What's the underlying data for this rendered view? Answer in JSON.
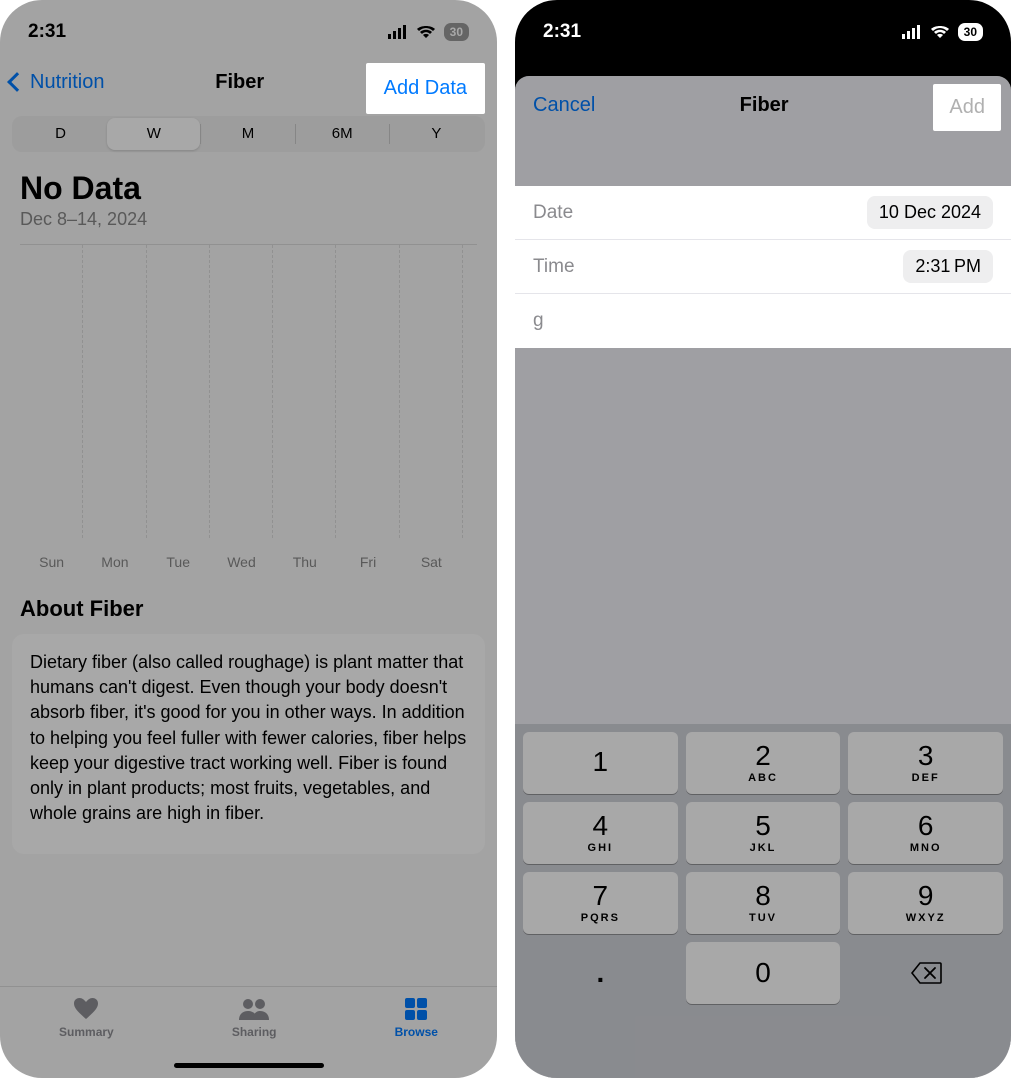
{
  "left": {
    "status": {
      "time": "2:31",
      "battery": "30"
    },
    "nav": {
      "back": "Nutrition",
      "title": "Fiber",
      "add_data": "Add Data"
    },
    "segments": [
      "D",
      "W",
      "M",
      "6M",
      "Y"
    ],
    "segment_selected": 1,
    "chart": {
      "heading": "No Data",
      "range": "Dec 8–14, 2024",
      "days": [
        "Sun",
        "Mon",
        "Tue",
        "Wed",
        "Thu",
        "Fri",
        "Sat"
      ]
    },
    "about": {
      "title": "About Fiber",
      "body": "Dietary fiber (also called roughage) is plant matter that humans can't digest. Even though your body doesn't absorb fiber, it's good for you in other ways. In addition to helping you feel fuller with fewer calories, fiber helps keep your digestive tract working well. Fiber is found only in plant products; most fruits, vegetables, and whole grains are high in fiber."
    },
    "tabs": {
      "summary": "Summary",
      "sharing": "Sharing",
      "browse": "Browse"
    }
  },
  "right": {
    "status": {
      "time": "2:31",
      "battery": "30"
    },
    "sheet": {
      "cancel": "Cancel",
      "title": "Fiber",
      "add": "Add",
      "date_label": "Date",
      "date_value": "10 Dec 2024",
      "time_label": "Time",
      "time_value": "2:31 PM",
      "unit_label": "g"
    },
    "keypad": {
      "keys": [
        {
          "num": "1",
          "sub": ""
        },
        {
          "num": "2",
          "sub": "ABC"
        },
        {
          "num": "3",
          "sub": "DEF"
        },
        {
          "num": "4",
          "sub": "GHI"
        },
        {
          "num": "5",
          "sub": "JKL"
        },
        {
          "num": "6",
          "sub": "MNO"
        },
        {
          "num": "7",
          "sub": "PQRS"
        },
        {
          "num": "8",
          "sub": "TUV"
        },
        {
          "num": "9",
          "sub": "WXYZ"
        }
      ],
      "dot": ".",
      "zero": "0"
    }
  }
}
